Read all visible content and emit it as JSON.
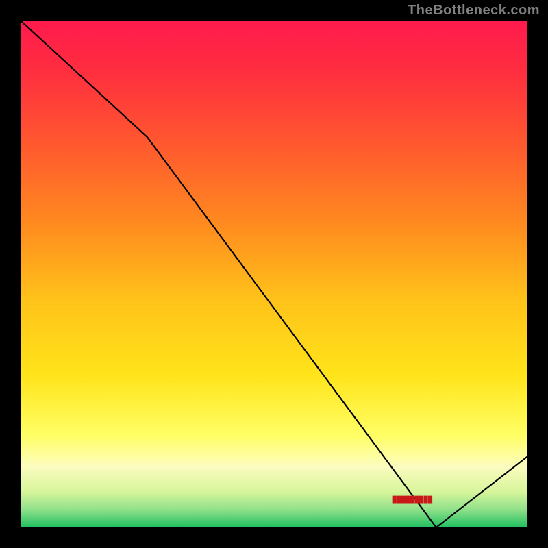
{
  "attribution": "TheBottleneck.com",
  "annotation_text": "█████████",
  "chart_data": {
    "type": "line",
    "title": "",
    "xlabel": "",
    "ylabel": "",
    "xlim": [
      0,
      100
    ],
    "ylim": [
      0,
      100
    ],
    "grid": false,
    "legend": false,
    "background": {
      "type": "vertical-gradient",
      "stops": [
        {
          "offset": 0.0,
          "color": "#ff1a4d"
        },
        {
          "offset": 0.1,
          "color": "#ff2e3f"
        },
        {
          "offset": 0.25,
          "color": "#ff5a2e"
        },
        {
          "offset": 0.4,
          "color": "#ff8a1f"
        },
        {
          "offset": 0.55,
          "color": "#ffc21a"
        },
        {
          "offset": 0.7,
          "color": "#ffe41a"
        },
        {
          "offset": 0.82,
          "color": "#ffff66"
        },
        {
          "offset": 0.88,
          "color": "#fcfcc0"
        },
        {
          "offset": 0.93,
          "color": "#d6f59a"
        },
        {
          "offset": 0.965,
          "color": "#8fe08a"
        },
        {
          "offset": 1.0,
          "color": "#20c060"
        }
      ]
    },
    "series": [
      {
        "name": "bottleneck-curve",
        "color": "#000000",
        "x": [
          0,
          25,
          82,
          100
        ],
        "y": [
          100,
          77,
          0,
          14
        ]
      }
    ],
    "annotations": [
      {
        "x": 77,
        "y": 0.5,
        "text_key": "annotation_text",
        "color": "#c81818"
      }
    ]
  },
  "colors": {
    "page_bg": "#000000",
    "attribution": "#808080",
    "annotation": "#c81818",
    "line": "#000000"
  }
}
